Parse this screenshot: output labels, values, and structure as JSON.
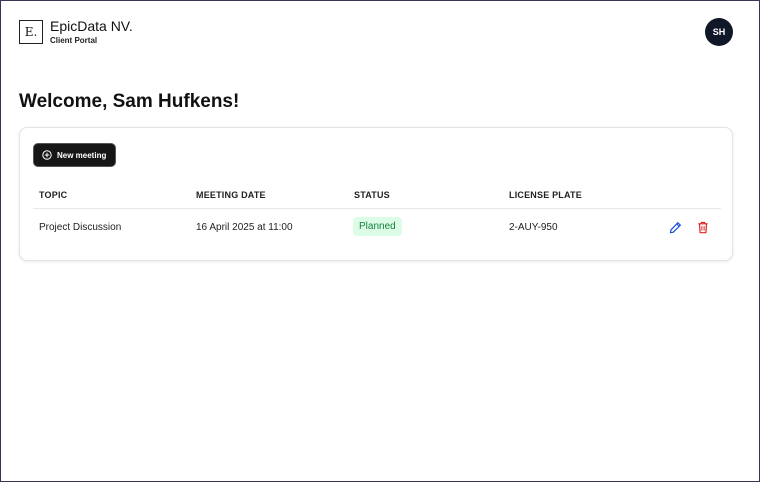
{
  "brand": {
    "logo_letter": "E.",
    "name": "EpicData NV.",
    "subtitle": "Client Portal"
  },
  "user": {
    "initials": "SH"
  },
  "welcome": "Welcome, Sam Hufkens!",
  "actions": {
    "new_meeting_label": "New meeting",
    "new_meeting_icon": "plus-circle-icon"
  },
  "table": {
    "columns": [
      "TOPIC",
      "MEETING DATE",
      "STATUS",
      "LICENSE PLATE"
    ],
    "rows": [
      {
        "topic": "Project Discussion",
        "meeting_date": "16 April 2025 at 11:00",
        "status": "Planned",
        "license_plate": "2-AUY-950",
        "edit_icon": "pencil-icon",
        "delete_icon": "trash-icon"
      }
    ]
  },
  "colors": {
    "avatar_bg": "#0f1729",
    "button_bg": "#161616",
    "status_planned_bg": "#dcfce7",
    "status_planned_text": "#15803d",
    "edit_icon": "#1d4ed8",
    "delete_icon": "#dc2626"
  }
}
